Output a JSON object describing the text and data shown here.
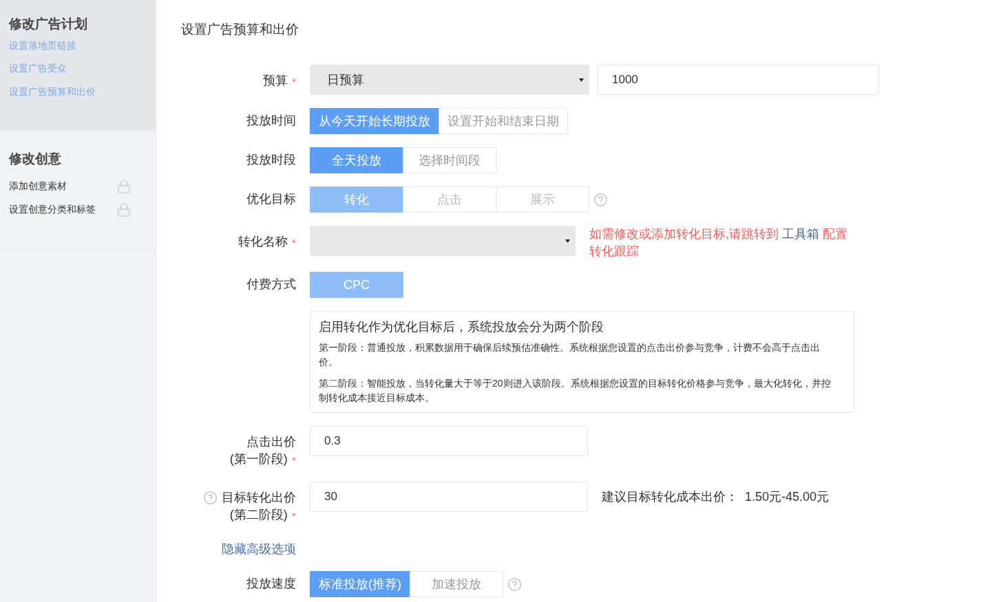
{
  "sidebar": {
    "sections": [
      {
        "title": "修改广告计划",
        "items": [
          {
            "label": "设置落地页链接",
            "locked": false
          },
          {
            "label": "设置广告受众",
            "locked": false
          },
          {
            "label": "设置广告预算和出价",
            "locked": false
          }
        ]
      },
      {
        "title": "修改创意",
        "items": [
          {
            "label": "添加创意素材",
            "locked": true
          },
          {
            "label": "设置创意分类和标签",
            "locked": true
          }
        ]
      }
    ]
  },
  "form": {
    "title": "设置广告预算和出价",
    "rows": [
      {
        "kind": "select_input",
        "label": [
          "预算"
        ],
        "required_mark": "*",
        "select": "日预算",
        "value": "1000"
      },
      {
        "kind": "segmented",
        "label": [
          "投放时间"
        ],
        "disabled": false,
        "help": false,
        "options": [
          {
            "label": "从今天开始长期投放",
            "selected": true
          },
          {
            "label": "设置开始和结束日期",
            "selected": false
          }
        ]
      },
      {
        "kind": "segmented",
        "label": [
          "投放时段"
        ],
        "disabled": false,
        "help": false,
        "options": [
          {
            "label": "全天投放",
            "selected": true
          },
          {
            "label": "选择时间段",
            "selected": false
          }
        ]
      },
      {
        "kind": "segmented",
        "label": [
          "优化目标"
        ],
        "disabled": true,
        "help": true,
        "options": [
          {
            "label": "转化",
            "selected": true
          },
          {
            "label": "点击",
            "selected": false
          },
          {
            "label": "展示",
            "selected": false
          }
        ]
      },
      {
        "kind": "select_note",
        "label": [
          "转化名称"
        ],
        "required_mark": "*",
        "note": "如需修改或添加转化目标,请跳转到",
        "link": "工具箱",
        "note_end": "配置转化跟踪"
      },
      {
        "kind": "segmented",
        "label": [
          "付费方式"
        ],
        "disabled": true,
        "help": false,
        "options": [
          {
            "label": "CPC",
            "selected": true
          }
        ]
      },
      {
        "kind": "info",
        "title": "启用转化作为优化目标后，系统投放会分为两个阶段",
        "paragraphs": [
          "第一阶段：普通投放，积累数据用于确保后续预估准确性。系统根据您设置的点击出价参与竞争，计费不会高于点击出价。",
          "第二阶段：智能投放，当转化量大于等于20则进入该阶段。系统根据您设置的目标转化价格参与竞争，最大化转化，并控制转化成本接近目标成本。"
        ]
      },
      {
        "kind": "input",
        "label": [
          "点击出价",
          "(第一阶段)"
        ],
        "required_mark": "*",
        "help": false,
        "value": "0.3"
      },
      {
        "kind": "input",
        "label": [
          "目标转化出价",
          "(第二阶段)"
        ],
        "required_mark": "*",
        "help": true,
        "value": "30",
        "hint": "建议目标转化成本出价：",
        "hint_value": "1.50元-45.00元"
      },
      {
        "kind": "link",
        "label": "隐藏高级选项"
      },
      {
        "kind": "segmented",
        "label": [
          "投放速度"
        ],
        "disabled": false,
        "help": true,
        "options": [
          {
            "label": "标准投放(推荐)",
            "selected": true
          },
          {
            "label": "加速投放",
            "selected": false
          }
        ]
      }
    ]
  }
}
